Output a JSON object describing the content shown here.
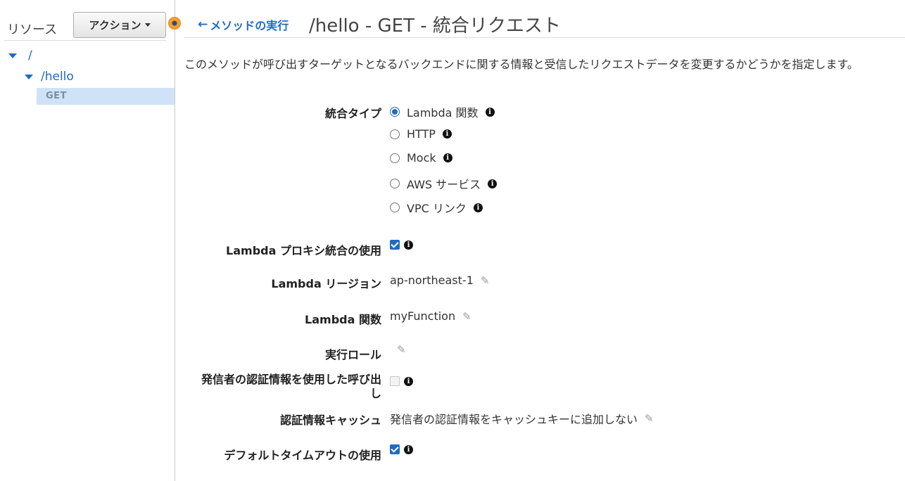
{
  "sidebar": {
    "title": "リソース",
    "action_label": "アクション",
    "tree": {
      "root": "/",
      "child": "/hello",
      "method": "GET"
    }
  },
  "header": {
    "back_label": "メソッドの実行",
    "title": "/hello - GET - 統合リクエスト"
  },
  "description": "このメソッドが呼び出すターゲットとなるバックエンドに関する情報と受信したリクエストデータを変更するかどうかを指定します。",
  "form": {
    "integration_type": {
      "label": "統合タイプ",
      "selected": "Lambda 関数",
      "options": [
        "Lambda 関数",
        "HTTP",
        "Mock",
        "AWS サービス",
        "VPC リンク"
      ]
    },
    "lambda_proxy": {
      "label": "Lambda プロキシ統合の使用",
      "checked": true
    },
    "lambda_region": {
      "label": "Lambda リージョン",
      "value": "ap-northeast-1"
    },
    "lambda_function": {
      "label": "Lambda 関数",
      "value": "myFunction"
    },
    "execution_role": {
      "label": "実行ロール",
      "value": ""
    },
    "invoke_with_caller_credentials": {
      "label_line1": "発信者の認証情報を使用した呼び出",
      "label_line2": "し",
      "checked": false
    },
    "credentials_cache": {
      "label": "認証情報キャッシュ",
      "value": "発信者の認証情報をキャッシュキーに追加しない"
    },
    "default_timeout": {
      "label": "デフォルトタイムアウトの使用",
      "checked": true
    }
  },
  "colors": {
    "link": "#1f6cbf",
    "selected_row": "#cfe2f7",
    "accent_dot": "#f0a033"
  }
}
